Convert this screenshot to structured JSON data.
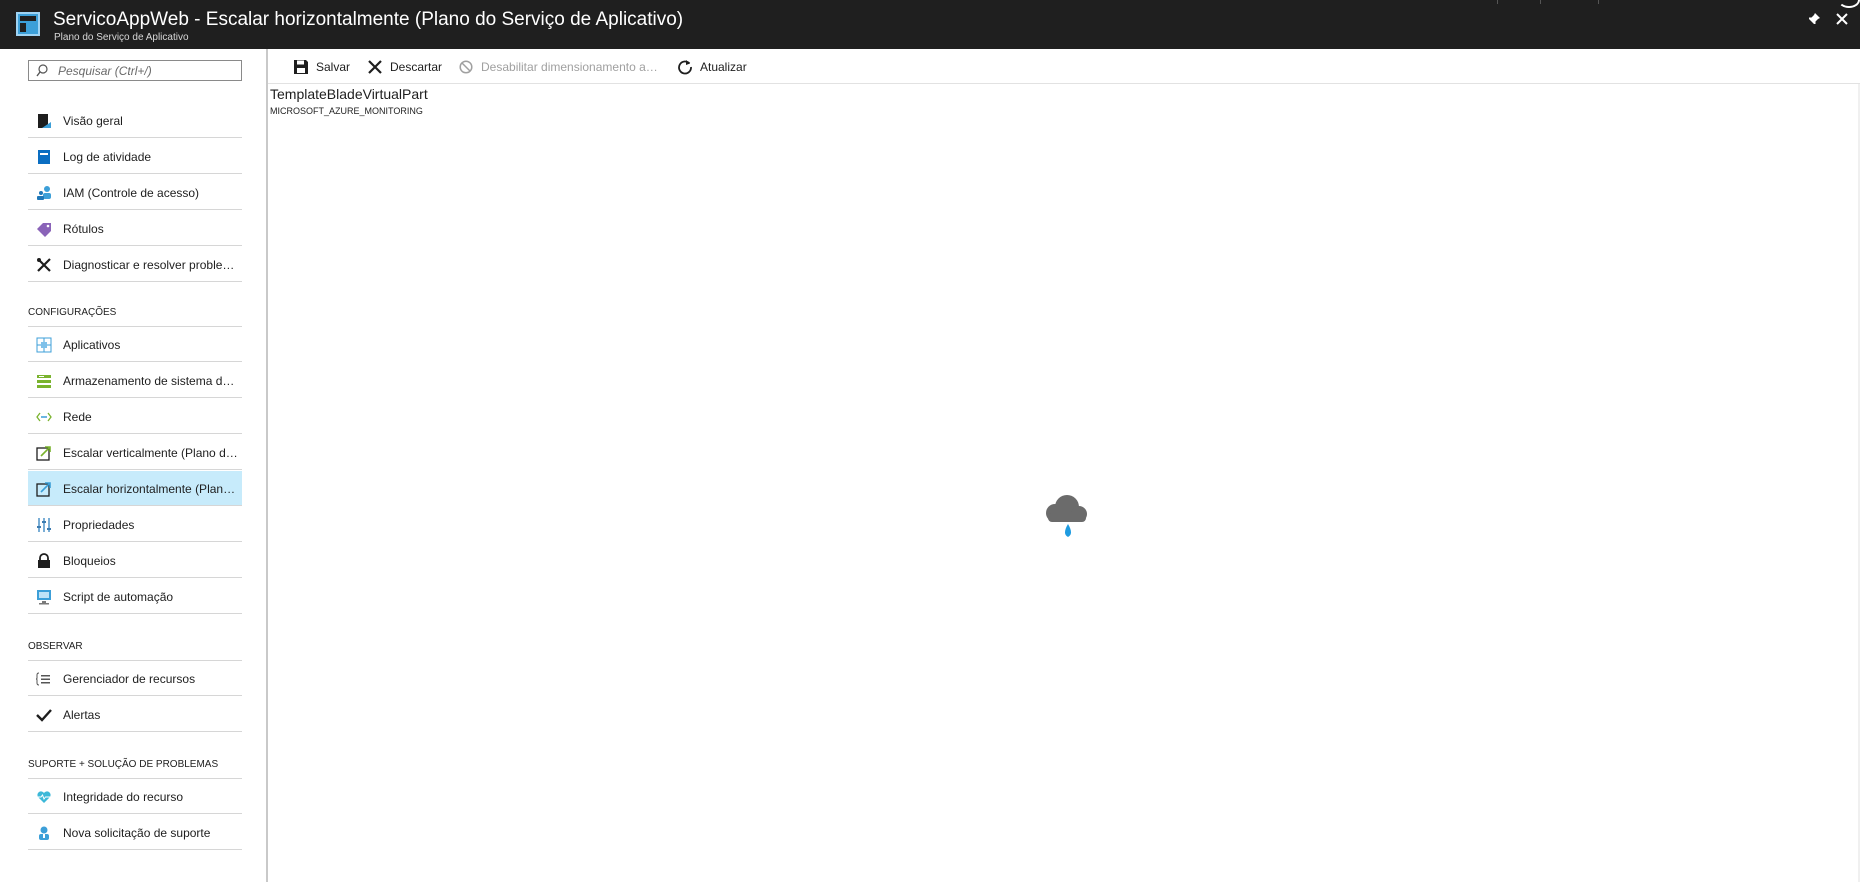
{
  "header": {
    "title": "ServicoAppWeb - Escalar horizontalmente (Plano do Serviço de Aplicativo)",
    "subtitle": "Plano do Serviço de Aplicativo",
    "pin_icon": "pin-icon",
    "close_icon": "close-icon"
  },
  "search": {
    "placeholder": "Pesquisar (Ctrl+/)"
  },
  "menu": {
    "top_items": [
      {
        "label": "Visão geral",
        "icon": "overview-icon"
      },
      {
        "label": "Log de atividade",
        "icon": "activity-log-icon"
      },
      {
        "label": "IAM (Controle de acesso)",
        "icon": "iam-icon"
      },
      {
        "label": "Rótulos",
        "icon": "tag-icon"
      },
      {
        "label": "Diagnosticar e resolver problemas",
        "icon": "wrench-icon"
      }
    ],
    "sections": [
      {
        "title": "CONFIGURAÇÕES",
        "items": [
          {
            "label": "Aplicativos",
            "icon": "apps-icon"
          },
          {
            "label": "Armazenamento de sistema de arquivos",
            "icon": "storage-icon"
          },
          {
            "label": "Rede",
            "icon": "network-icon"
          },
          {
            "label": "Escalar verticalmente (Plano do Serviço de Aplicativo)",
            "icon": "scale-up-icon"
          },
          {
            "label": "Escalar horizontalmente (Plano do Serviço de Aplicativo)",
            "icon": "scale-out-icon",
            "selected": true
          },
          {
            "label": "Propriedades",
            "icon": "properties-icon"
          },
          {
            "label": "Bloqueios",
            "icon": "lock-icon"
          },
          {
            "label": "Script de automação",
            "icon": "automation-script-icon"
          }
        ]
      },
      {
        "title": "OBSERVAR",
        "items": [
          {
            "label": "Gerenciador de recursos",
            "icon": "resource-explorer-icon"
          },
          {
            "label": "Alertas",
            "icon": "checkmark-icon"
          }
        ]
      },
      {
        "title": "SUPORTE + SOLUÇÃO DE PROBLEMAS",
        "items": [
          {
            "label": "Integridade do recurso",
            "icon": "heart-icon"
          },
          {
            "label": "Nova solicitação de suporte",
            "icon": "support-icon"
          }
        ]
      }
    ]
  },
  "toolbar": {
    "save": "Salvar",
    "discard": "Descartar",
    "disable_autoscale": "Desabilitar dimensionamento automático",
    "refresh": "Atualizar"
  },
  "content": {
    "part_title": "TemplateBladeVirtualPart",
    "part_subtitle": "MICROSOFT_AZURE_MONITORING",
    "loading_icon": "cloud-loading-icon"
  },
  "colors": {
    "header_bg": "#1f1f1f",
    "selected_bg": "#c7ebfb",
    "accent": "#0a86d1"
  }
}
